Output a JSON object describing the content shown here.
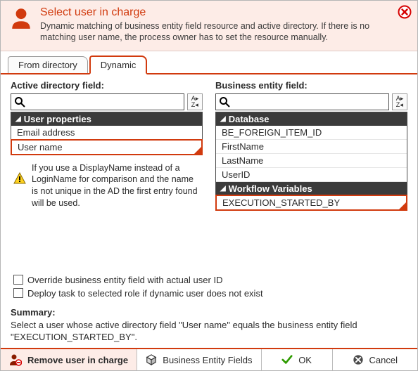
{
  "header": {
    "title": "Select user in charge",
    "description": "Dynamic matching of business entity field resource and active directory. If there is no matching user name, the process owner has to set the resource manually."
  },
  "tabs": {
    "from_directory": "From directory",
    "dynamic": "Dynamic"
  },
  "left": {
    "label": "Active directory field:",
    "group": "User properties",
    "items": {
      "email": "Email address",
      "username": "User name"
    },
    "warning": "If you use a DisplayName instead of a LoginName for comparison and the name is not unique in the AD the first entry found will be used."
  },
  "right": {
    "label": "Business entity field:",
    "group_db": "Database",
    "db_items": {
      "foreign": "BE_FOREIGN_ITEM_ID",
      "first": "FirstName",
      "last": "LastName",
      "uid": "UserID"
    },
    "group_wf": "Workflow Variables",
    "wf_items": {
      "exec": "EXECUTION_STARTED_BY"
    }
  },
  "checks": {
    "override": "Override business entity field with actual user ID",
    "deploy": "Deploy task to selected role if dynamic user does not exist"
  },
  "summary": {
    "label": "Summary:",
    "text": "Select a user whose active directory field \"User name\" equals the business entity field \"EXECUTION_STARTED_BY\"."
  },
  "footer": {
    "remove": "Remove user in charge",
    "be_fields": "Business Entity Fields",
    "ok": "OK",
    "cancel": "Cancel"
  }
}
